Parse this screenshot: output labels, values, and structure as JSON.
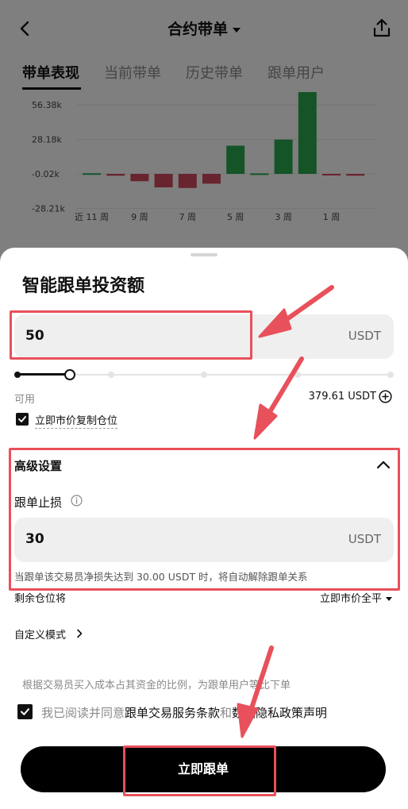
{
  "header": {
    "title": "合约带单",
    "back_icon": "chevron-left-icon",
    "share_icon": "share-upload-icon"
  },
  "tabs": [
    {
      "label": "带单表现",
      "active": true
    },
    {
      "label": "当前带单",
      "active": false
    },
    {
      "label": "历史带单",
      "active": false
    },
    {
      "label": "跟单用户",
      "active": false
    }
  ],
  "chart_data": {
    "type": "bar",
    "yticks": [
      "56.38k",
      "28.18k",
      "-0.02k",
      "-28.21k"
    ],
    "ytick_values": [
      56380,
      28180,
      -20,
      -28210
    ],
    "xtick_labels": [
      {
        "label": "近 11 周",
        "index": 0
      },
      {
        "label": "9 周",
        "index": 2
      },
      {
        "label": "7 周",
        "index": 4
      },
      {
        "label": "5 周",
        "index": 6
      },
      {
        "label": "3 周",
        "index": 8
      },
      {
        "label": "1 周",
        "index": 10
      }
    ],
    "values": [
      500,
      -1500,
      -6000,
      -11000,
      -11500,
      -8000,
      23000,
      400,
      28000,
      71000,
      -300,
      -1500
    ],
    "positive_color": "#2aa94f",
    "negative_color": "#d0495e",
    "ylim": [
      -30000,
      72000
    ]
  },
  "sheet": {
    "title": "智能跟单投资额",
    "amount": {
      "value": "50",
      "unit": "USDT"
    },
    "slider": {
      "fraction": 0.14,
      "stops": 5
    },
    "available": {
      "label": "可用",
      "value": "379.61 USDT",
      "add_icon": "plus-circle-icon"
    },
    "copy_position": {
      "label": "立即市价复制仓位",
      "checked": true
    },
    "advanced": {
      "title": "高级设置",
      "stop_loss_label": "跟单止损",
      "stop_loss": {
        "value": "30",
        "unit": "USDT"
      },
      "note": "当跟单该交易员净损失达到 30.00 USDT 时，将自动解除跟单关系",
      "remaining_label": "剩余仓位将",
      "remaining_option": "立即市价全平"
    },
    "custom_mode": "自定义模式",
    "ratio_note": "根据交易员买入成本占其资金的比例，为跟单用户等比下单",
    "agreement": {
      "checked": true,
      "prefix": "我已阅读并同意",
      "link1": "跟单交易服务条款",
      "joiner": "和",
      "link2": "数据隐私政策声明"
    },
    "submit": "立即跟单"
  },
  "annotation": {
    "color": "#e8505b"
  }
}
